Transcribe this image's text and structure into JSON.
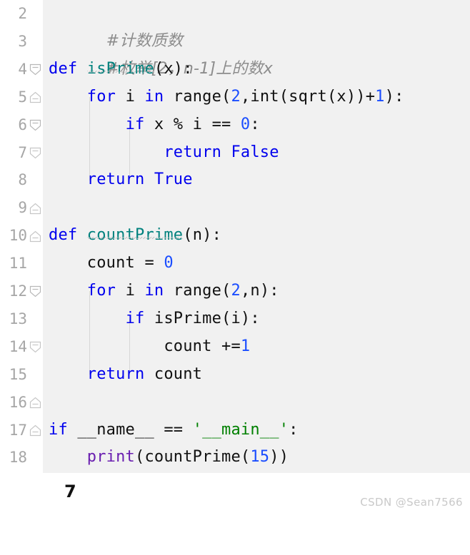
{
  "editor": {
    "language": "python",
    "background_color": "#f1f1f1",
    "gutter_color": "#a6a6a6",
    "colors": {
      "keyword": "#0000ee",
      "function_def": "#00817d",
      "number": "#1a4dff",
      "string": "#008000",
      "builtin": "#6a1fb0",
      "comment": "#8c8c8c",
      "plain": "#111111"
    },
    "lines": [
      {
        "number": "2",
        "fold": "collapse",
        "indent": 0
      },
      {
        "number": "3",
        "fold": "end",
        "indent": 0
      },
      {
        "number": "4",
        "fold": "collapse",
        "indent": 0
      },
      {
        "number": "5",
        "fold": "collapse",
        "indent": 1
      },
      {
        "number": "6",
        "fold": "none",
        "indent": 2
      },
      {
        "number": "7",
        "fold": "end",
        "indent": 3
      },
      {
        "number": "8",
        "fold": "end",
        "indent": 1
      },
      {
        "number": "9",
        "fold": "none",
        "indent": 0
      },
      {
        "number": "10",
        "fold": "collapse",
        "indent": 0
      },
      {
        "number": "11",
        "fold": "none",
        "indent": 1
      },
      {
        "number": "12",
        "fold": "collapse",
        "indent": 1
      },
      {
        "number": "13",
        "fold": "none",
        "indent": 2
      },
      {
        "number": "14",
        "fold": "end",
        "indent": 3
      },
      {
        "number": "15",
        "fold": "end",
        "indent": 1
      },
      {
        "number": "16",
        "fold": "none",
        "indent": 0
      },
      {
        "number": "17",
        "fold": "none",
        "indent": 0
      },
      {
        "number": "18",
        "fold": "none",
        "indent": 1
      }
    ],
    "code": {
      "l2_comment": "#计数质数",
      "l3_comment": "#枚举[2，n-1]上的数x",
      "l4_def": "def",
      "l4_name": "isPrime",
      "l4_rest": "(x):",
      "l5_indent": "    ",
      "l5_for": "for",
      "l5_i": " i ",
      "l5_in": "in",
      "l5_range": " range(",
      "l5_two": "2",
      "l5_int": ",int(sqrt(x))+",
      "l5_one": "1",
      "l5_close": "):",
      "l6_indent": "        ",
      "l6_if": "if",
      "l6_expr": " x % i == ",
      "l6_zero": "0",
      "l6_colon": ":",
      "l7_indent": "            ",
      "l7_return": "return",
      "l7_false": " False",
      "l8_indent": "    ",
      "l8_return": "return",
      "l8_true": " True",
      "l10_def": "def",
      "l10_name": "countPrime",
      "l10_rest": "(n):",
      "l11_indent": "    ",
      "l11_expr": "count = ",
      "l11_zero": "0",
      "l12_indent": "    ",
      "l12_for": "for",
      "l12_i": " i ",
      "l12_in": "in",
      "l12_range": " range(",
      "l12_two": "2",
      "l12_rest": ",n):",
      "l13_indent": "        ",
      "l13_if": "if",
      "l13_expr": " isPrime(i):",
      "l14_indent": "            ",
      "l14_expr": "count +=",
      "l14_one": "1",
      "l15_indent": "    ",
      "l15_return": "return",
      "l15_expr": " count",
      "l17_if": "if",
      "l17_name": " __name__ == ",
      "l17_str": "'__main__'",
      "l17_colon": ":",
      "l18_indent": "    ",
      "l18_print": "print",
      "l18_call": "(countPrime(",
      "l18_num": "15",
      "l18_close": "))"
    }
  },
  "output": {
    "value": "7"
  },
  "watermark": {
    "text": "CSDN @Sean7566"
  }
}
